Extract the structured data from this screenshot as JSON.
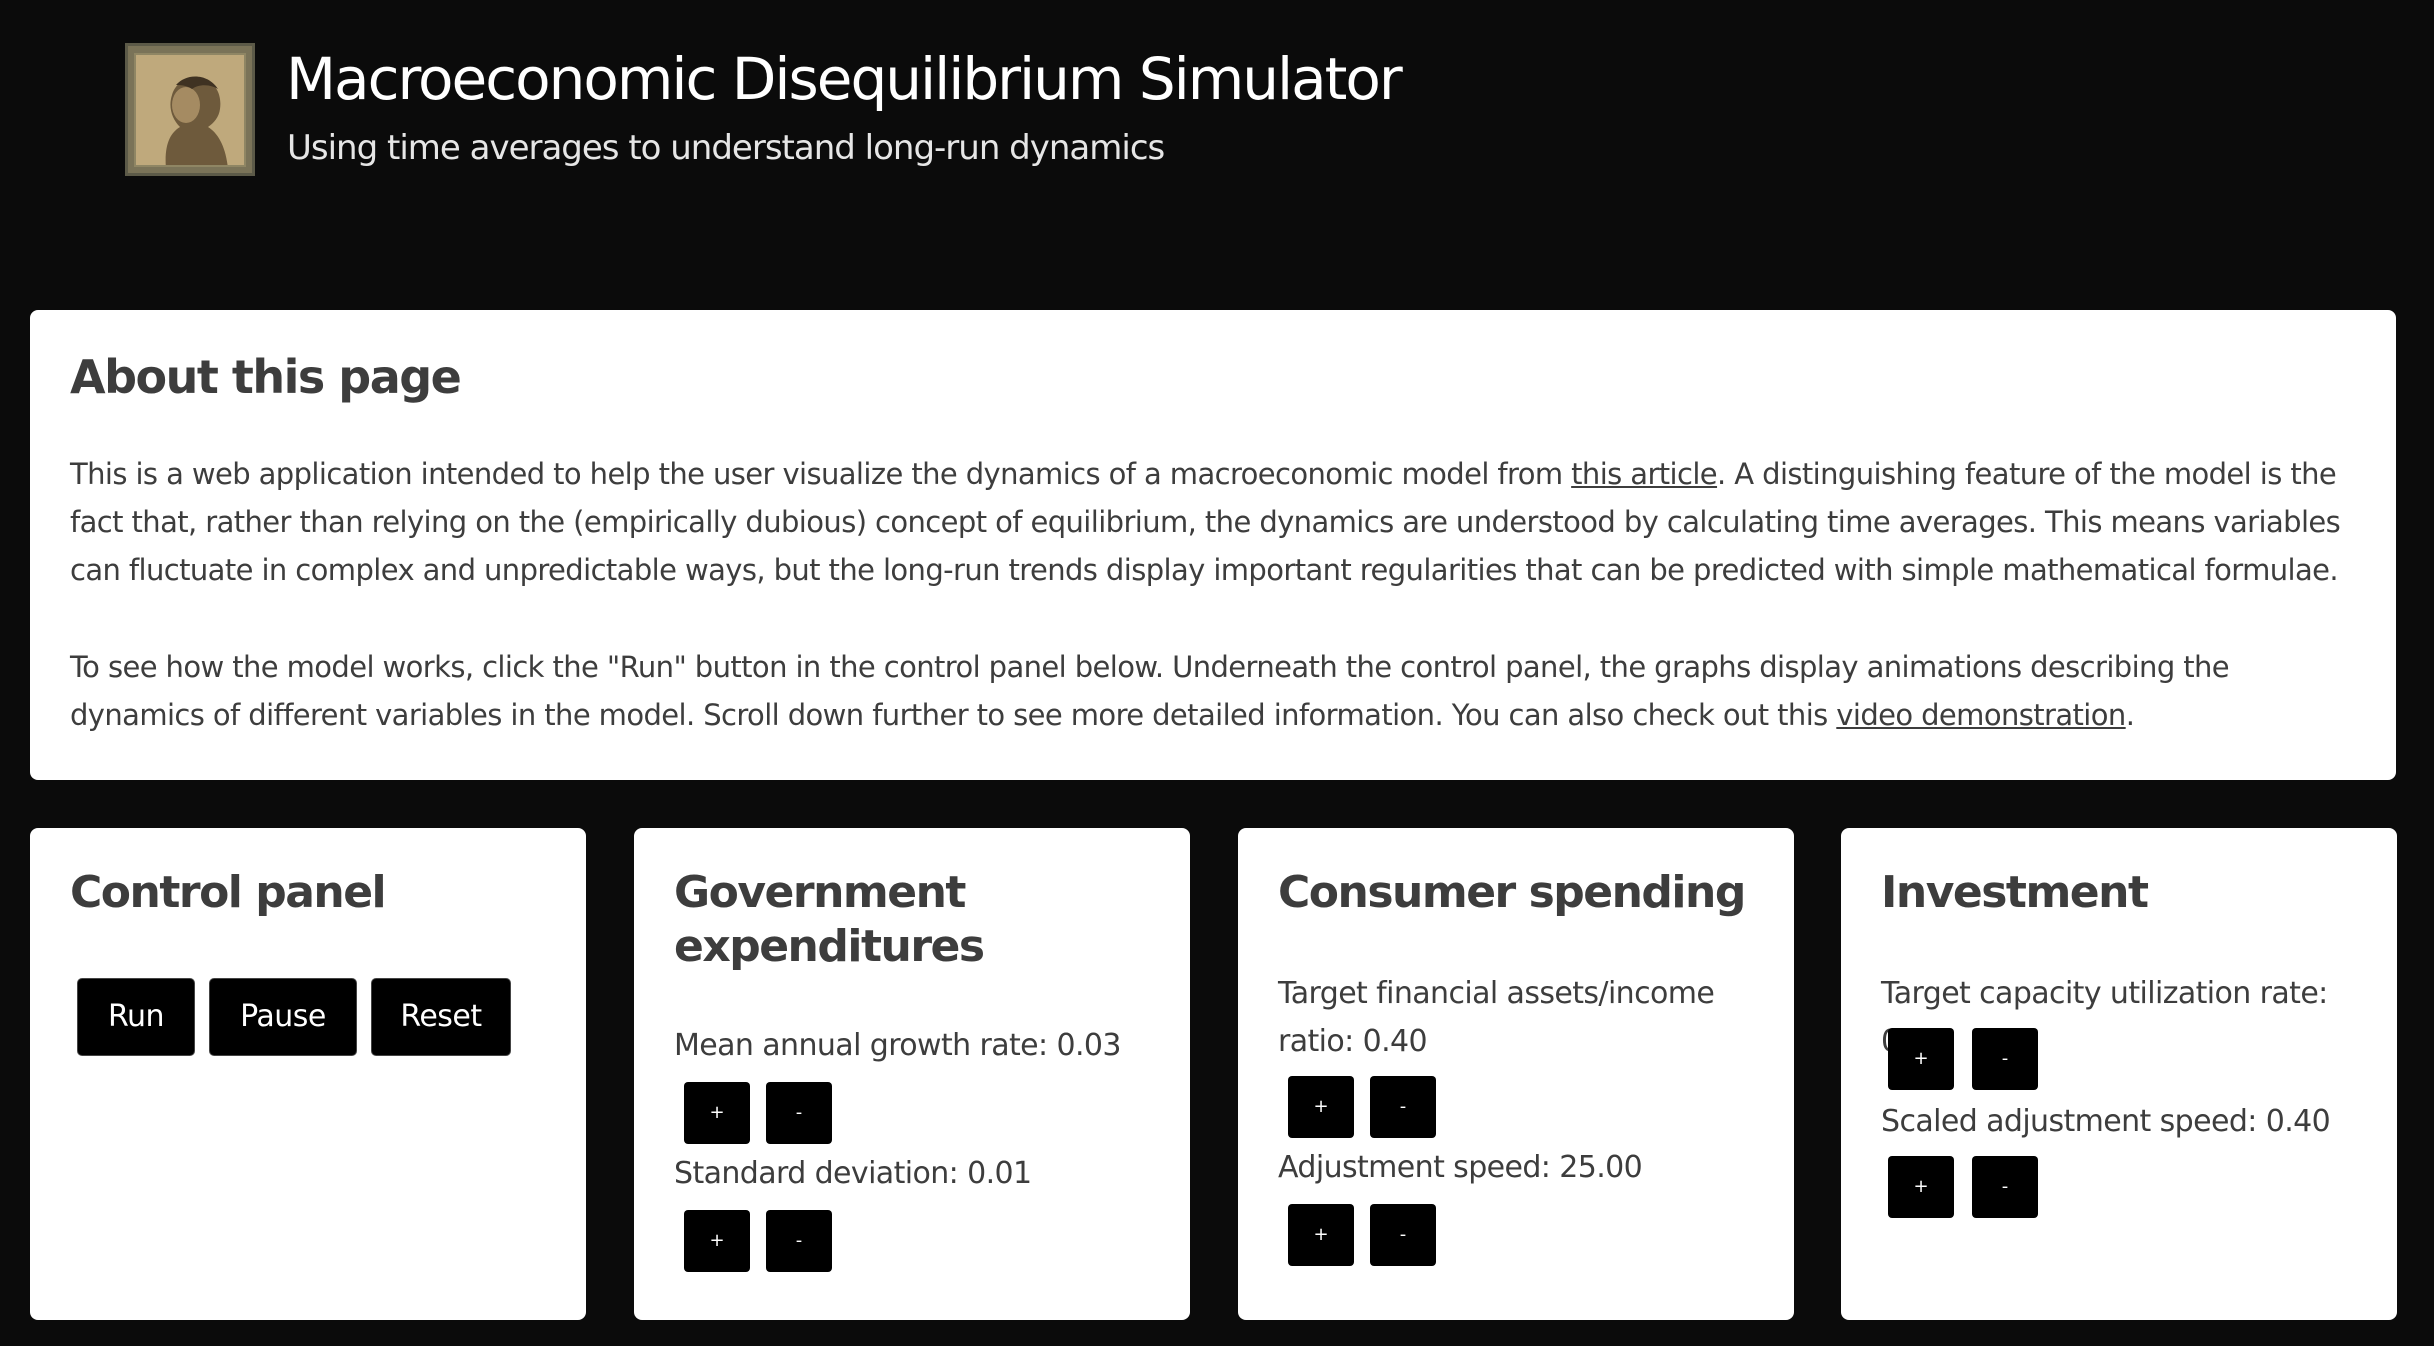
{
  "header": {
    "title": "Macroeconomic Disequilibrium Simulator",
    "subtitle": "Using time averages to understand long-run dynamics"
  },
  "about": {
    "heading": "About this page",
    "p1_before": "This is a web application intended to help the user visualize the dynamics of a macroeconomic model from ",
    "p1_link": "this article",
    "p1_after": ". A distinguishing feature of the model is the fact that, rather than relying on the (empirically dubious) concept of equilibrium, the dynamics are understood by calculating time averages. This means variables can fluctuate in complex and unpredictable ways, but the long-run trends display important regularities that can be predicted with simple mathematical formulae.",
    "p2_before": "To see how the model works, click the \"Run\" button in the control panel below. Underneath the control panel, the graphs display animations describing the dynamics of different variables in the model. Scroll down further to see more detailed information. You can also check out this ",
    "p2_link": "video demonstration",
    "p2_after": "."
  },
  "control_panel": {
    "heading": "Control panel",
    "run_label": "Run",
    "pause_label": "Pause",
    "reset_label": "Reset"
  },
  "government": {
    "heading": "Government expenditures",
    "growth_label": "Mean annual growth rate: 0.03",
    "stdev_label": "Standard deviation: 0.01"
  },
  "consumer": {
    "heading": "Consumer spending",
    "target_label": "Target financial assets/income ratio: 0.40",
    "speed_label": "Adjustment speed: 25.00"
  },
  "investment": {
    "heading": "Investment",
    "target_label": "Target capacity utilization rate: 0.75",
    "speed_label": "Scaled adjustment speed: 0.40"
  },
  "buttons": {
    "plus": "+",
    "minus": "-"
  }
}
